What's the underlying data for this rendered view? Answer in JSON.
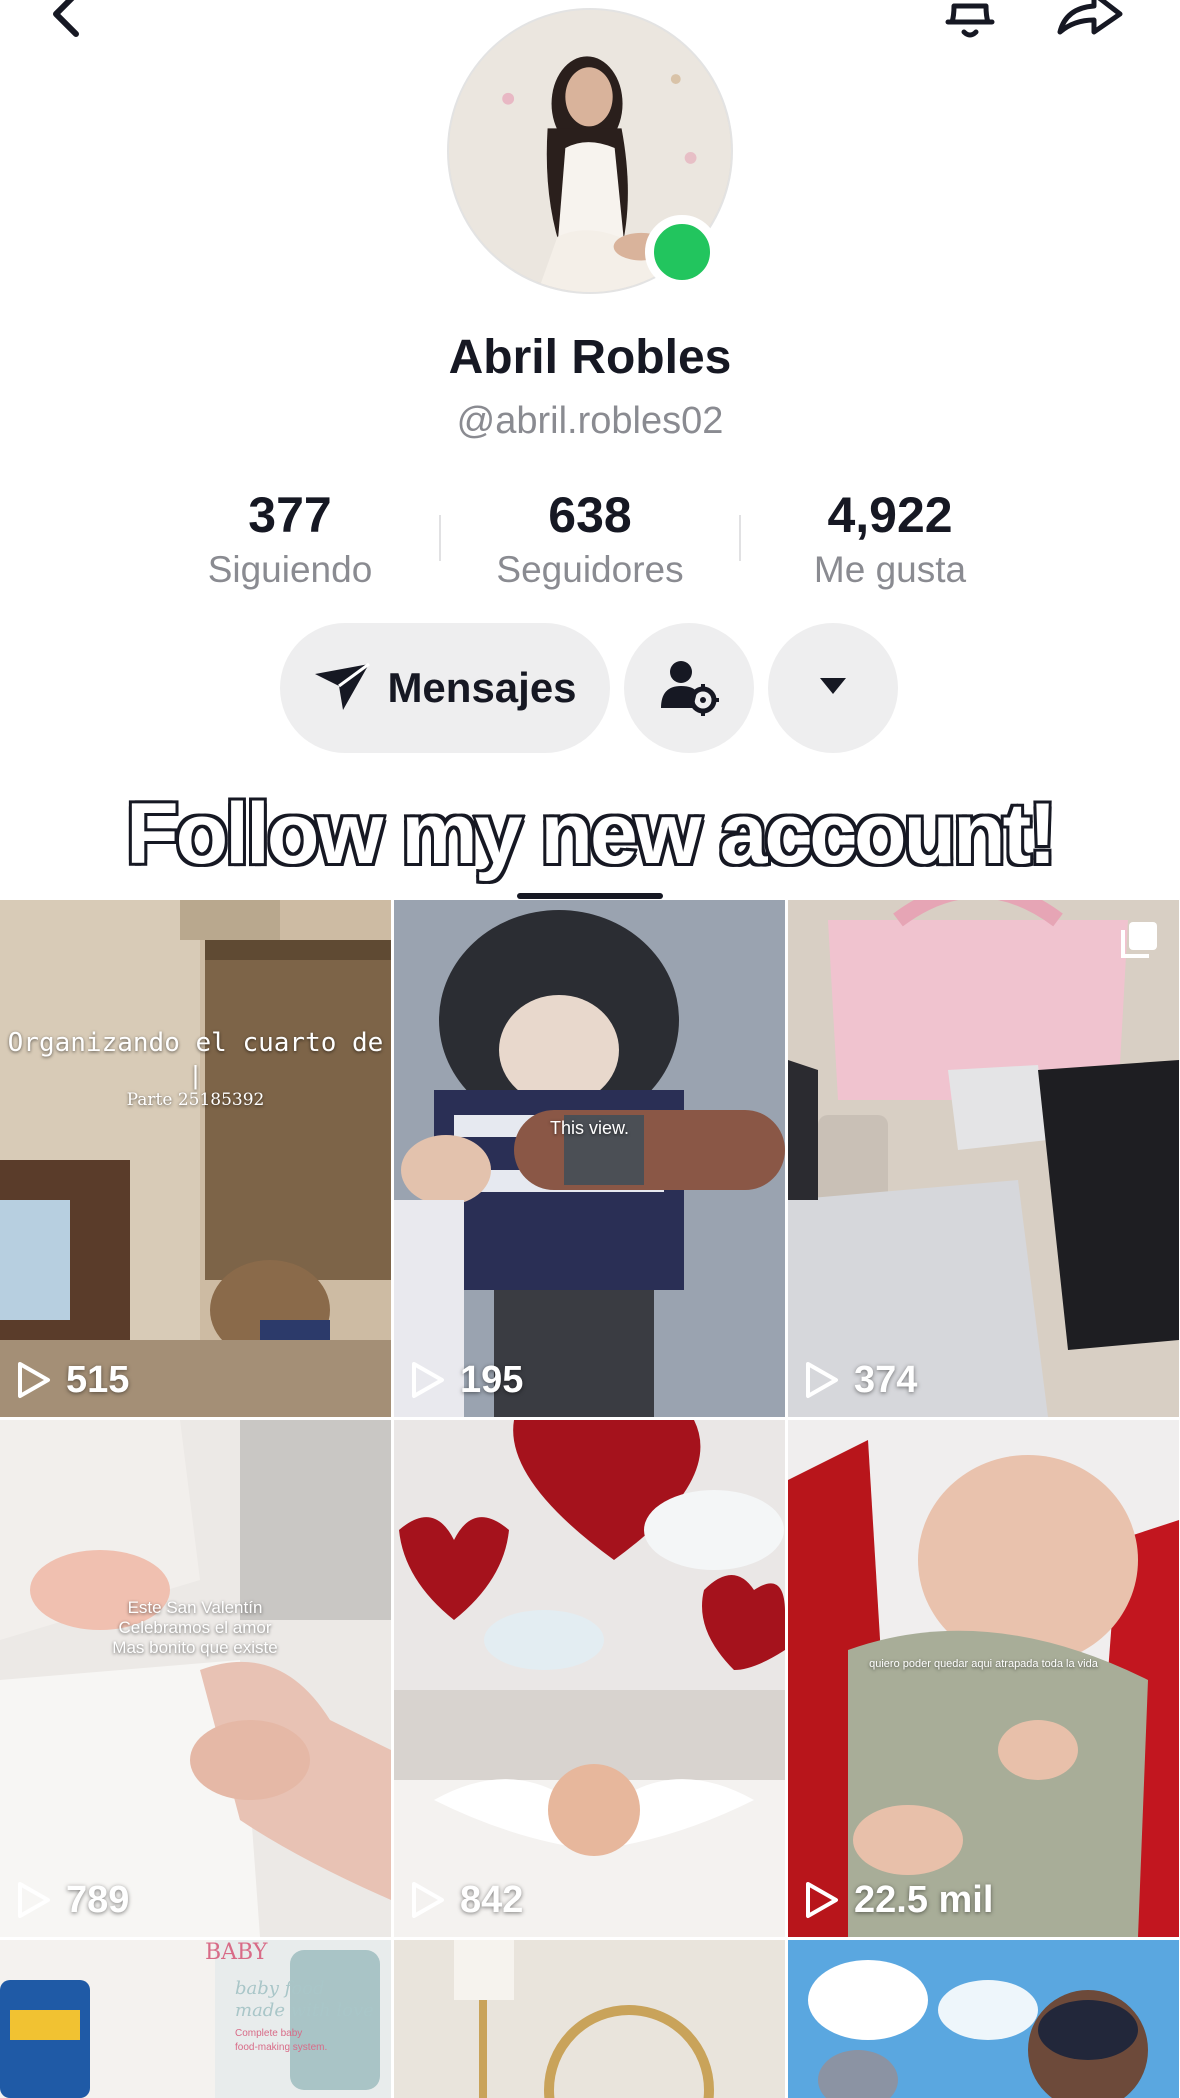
{
  "profile": {
    "display_name": "Abril Robles",
    "handle": "@abril.robles02",
    "online_color": "#22c55e"
  },
  "stats": [
    {
      "value": "377",
      "label": "Siguiendo"
    },
    {
      "value": "638",
      "label": "Seguidores"
    },
    {
      "value": "4,922",
      "label": "Me gusta"
    }
  ],
  "actions": {
    "message_label": "Mensajes",
    "message_icon": "send-icon",
    "add_friend_icon": "user-settings-icon",
    "more_icon": "caret-down-icon"
  },
  "bio": "Follow my new account!",
  "videos": [
    {
      "views": "515",
      "overlay": [
        "Organizando el cuarto de",
        "|",
        "Parte 25185392"
      ],
      "theme": "nursery"
    },
    {
      "views": "195",
      "overlay": [
        "This view."
      ],
      "theme": "stroller"
    },
    {
      "views": "374",
      "overlay": [],
      "theme": "clothes",
      "carousel": true
    },
    {
      "views": "789",
      "overlay": [
        "Este San Valentín",
        "Celebramos el amor",
        "Mas bonito que existe"
      ],
      "theme": "newborn"
    },
    {
      "views": "842",
      "overlay": [],
      "theme": "hearts"
    },
    {
      "views": "22.5 mil",
      "overlay": [
        "quiero poder quedar aqui atrapada toda la vida"
      ],
      "theme": "sleeping"
    },
    {
      "views": "",
      "overlay": [
        "BABY",
        "baby food",
        "made with love",
        "Complete baby",
        "food-making system."
      ],
      "theme": "babyfood"
    },
    {
      "views": "",
      "overlay": [],
      "theme": "room"
    },
    {
      "views": "",
      "overlay": [],
      "theme": "beach"
    }
  ]
}
